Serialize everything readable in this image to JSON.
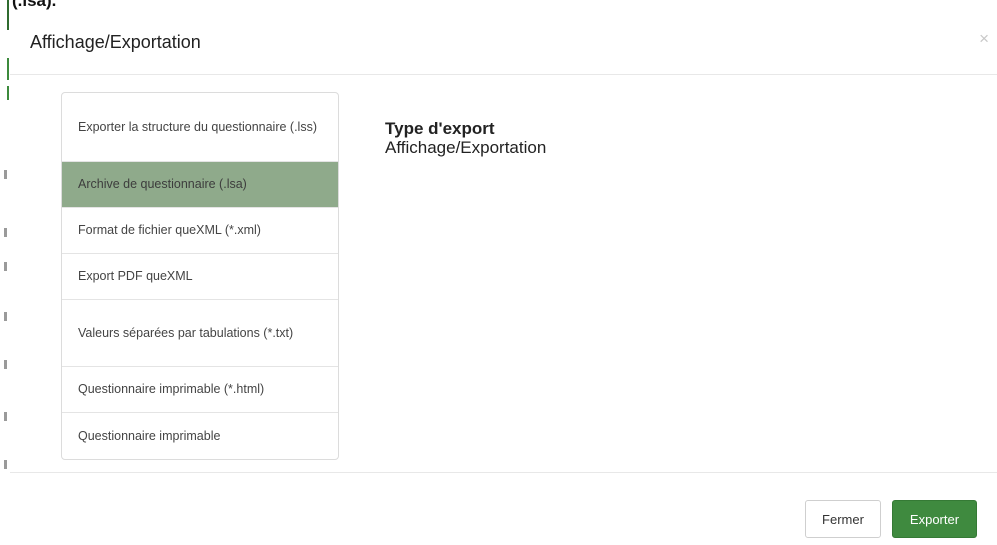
{
  "background": {
    "heading_fragment": "(.lsa)."
  },
  "modal": {
    "title": "Affichage/Exportation",
    "close_glyph": "×",
    "list_items": [
      {
        "label": "Exporter la structure du questionnaire (.lss)",
        "active": false
      },
      {
        "label": "Archive de questionnaire (.lsa)",
        "active": true
      },
      {
        "label": "Format de fichier queXML (*.xml)",
        "active": false
      },
      {
        "label": "Export PDF queXML",
        "active": false
      },
      {
        "label": "Valeurs séparées par tabulations (*.txt)",
        "active": false
      },
      {
        "label": "Questionnaire imprimable (*.html)",
        "active": false
      },
      {
        "label": "Questionnaire imprimable",
        "active": false
      }
    ],
    "content": {
      "title_line1": "Type d'export",
      "title_line2": "Affichage/Exportation"
    },
    "footer": {
      "close_label": "Fermer",
      "export_label": "Exporter"
    }
  },
  "colors": {
    "active_item_bg": "#8faa8b",
    "primary_button": "#3f8a3f",
    "edge_accent": "#2f6b2f"
  }
}
